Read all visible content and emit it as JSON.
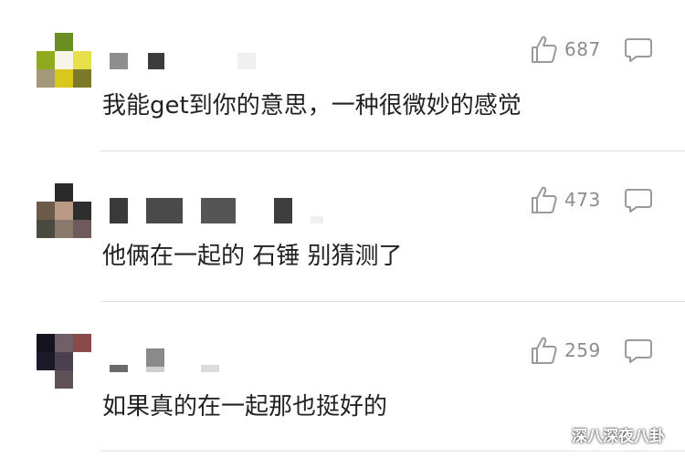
{
  "comments": [
    {
      "likes": "687",
      "text": "我能get到你的意思，一种很微妙的感觉",
      "avatar_colors": [
        "#ffffff",
        "#6b8e23",
        "#ffffff",
        "#8faa1d",
        "#f6f3e8",
        "#e8e04a",
        "#a39878",
        "#d8c81c",
        "#7b7a2a"
      ]
    },
    {
      "likes": "473",
      "text": "他俩在一起的 石锤 别猜测了",
      "avatar_colors": [
        "#ffffff",
        "#2b2b2b",
        "#ffffff",
        "#6b5a48",
        "#b89a86",
        "#2e2e2e",
        "#4a4a40",
        "#8a7a6c",
        "#6e5a5c"
      ]
    },
    {
      "likes": "259",
      "text": "如果真的在一起那也挺好的",
      "avatar_colors": [
        "#141420",
        "#6e6066",
        "#8a4a4a",
        "#1a1a28",
        "#4a4050",
        "#ffffff",
        "#ffffff",
        "#5e5258",
        "#ffffff"
      ]
    }
  ],
  "watermark": {
    "text": "深八深夜八卦",
    "icon": "wechat-icon"
  },
  "icons": {
    "like": "thumbs-up-icon",
    "reply": "comment-bubble-icon"
  },
  "colors": {
    "text": "#222222",
    "count": "#8c8c8c",
    "divider": "#e2e2e2"
  }
}
